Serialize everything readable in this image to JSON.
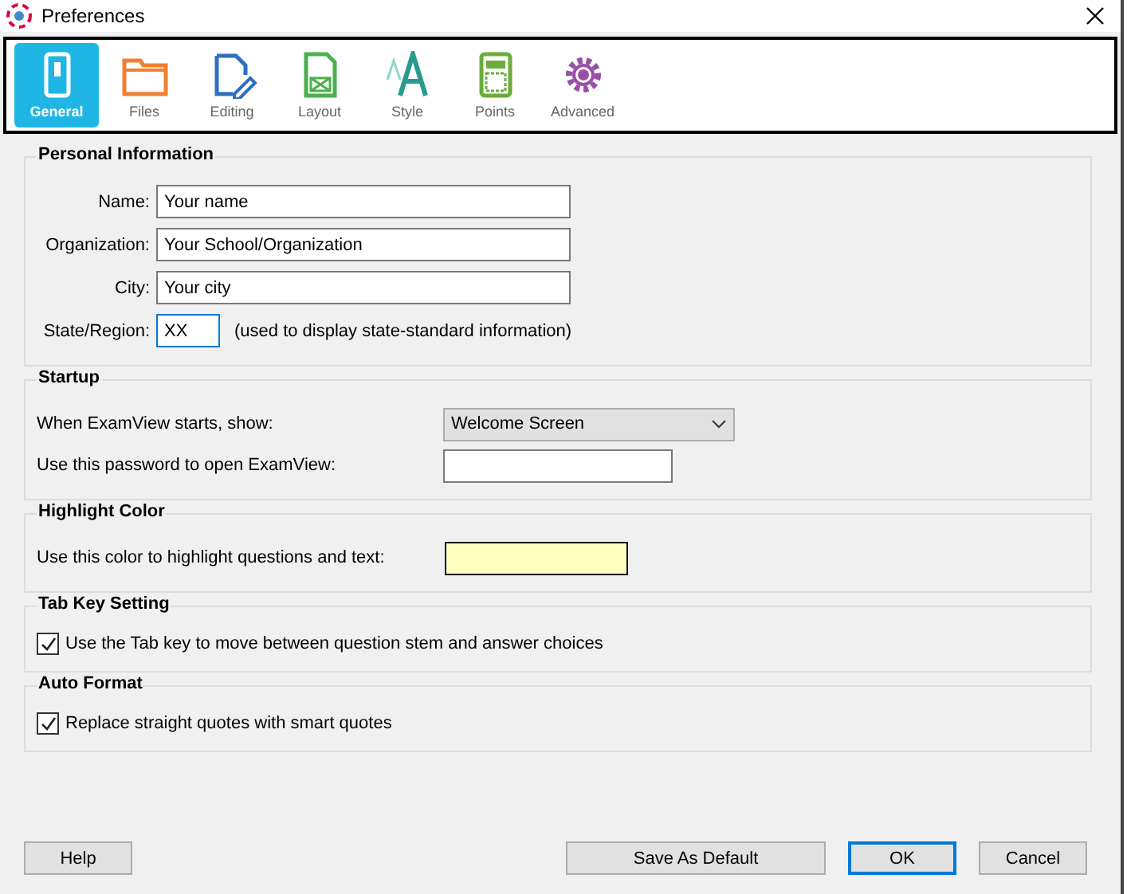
{
  "window": {
    "title": "Preferences"
  },
  "tabs": [
    {
      "label": "General",
      "kind": "general",
      "selected": true
    },
    {
      "label": "Files",
      "kind": "files",
      "selected": false
    },
    {
      "label": "Editing",
      "kind": "editing",
      "selected": false
    },
    {
      "label": "Layout",
      "kind": "layout",
      "selected": false
    },
    {
      "label": "Style",
      "kind": "style",
      "selected": false
    },
    {
      "label": "Points",
      "kind": "points",
      "selected": false
    },
    {
      "label": "Advanced",
      "kind": "advanced",
      "selected": false
    }
  ],
  "personal": {
    "title": "Personal Information",
    "fields": [
      {
        "label": "Name:",
        "value": "Your name"
      },
      {
        "label": "Organization:",
        "value": "Your School/Organization"
      },
      {
        "label": "City:",
        "value": "Your city"
      }
    ],
    "state": {
      "label": "State/Region:",
      "value": "XX",
      "note": "(used to display state-standard information)"
    }
  },
  "startup": {
    "title": "Startup",
    "show_label": "When ExamView starts, show:",
    "show_value": "Welcome Screen",
    "password_label": "Use this password to open ExamView:"
  },
  "highlight": {
    "title": "Highlight Color",
    "label": "Use this color to highlight questions and text:",
    "color": "#ffffc0"
  },
  "tab_key": {
    "title": "Tab Key Setting",
    "label": "Use the Tab key to move between question stem and answer choices",
    "checked": true
  },
  "auto_format": {
    "title": "Auto Format",
    "label": "Replace straight quotes with smart quotes",
    "checked": true
  },
  "buttons": {
    "help": "Help",
    "save_default": "Save As Default",
    "ok": "OK",
    "cancel": "Cancel"
  }
}
